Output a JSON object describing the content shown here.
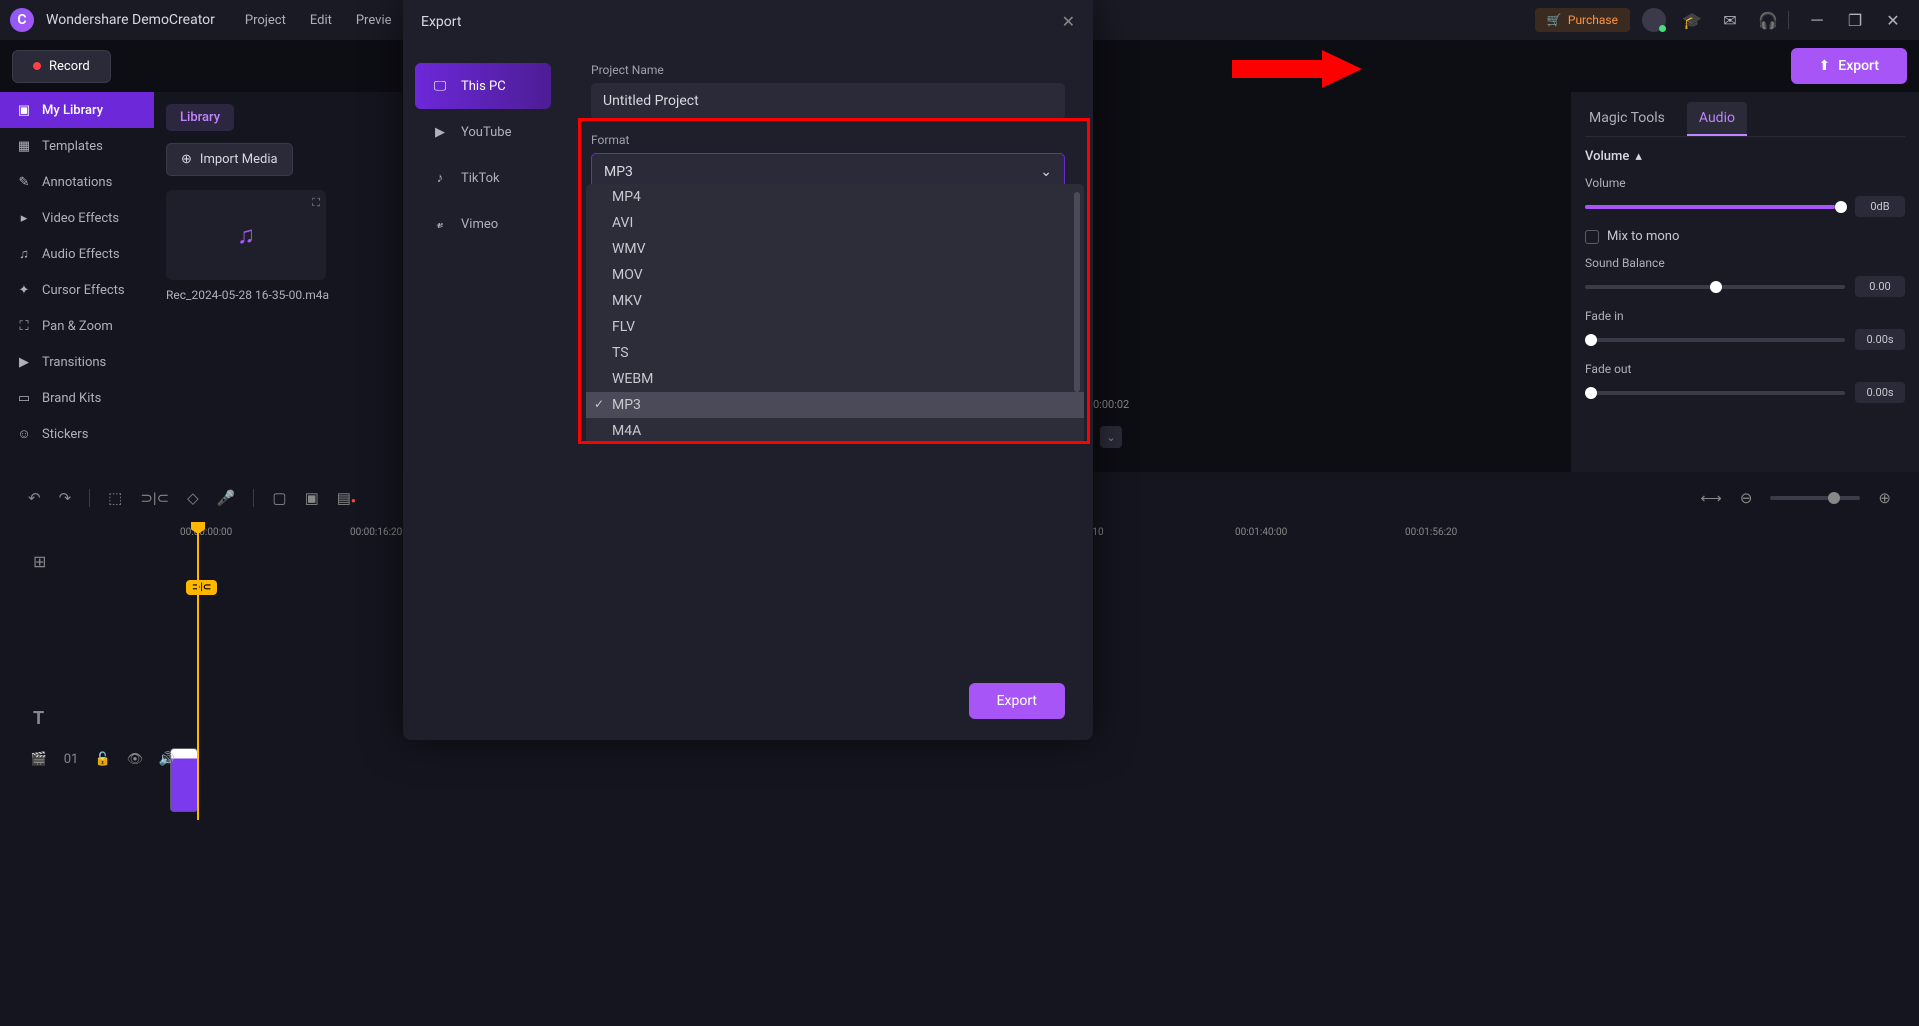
{
  "titlebar": {
    "appname": "Wondershare DemoCreator",
    "menus": [
      "Project",
      "Edit",
      "Previe"
    ],
    "purchase": "Purchase"
  },
  "toolbar": {
    "record": "Record",
    "export": "Export"
  },
  "sidebar": {
    "items": [
      {
        "label": "My Library",
        "icon": "library"
      },
      {
        "label": "Templates",
        "icon": "templates"
      },
      {
        "label": "Annotations",
        "icon": "annotations"
      },
      {
        "label": "Video Effects",
        "icon": "video-fx"
      },
      {
        "label": "Audio Effects",
        "icon": "audio-fx"
      },
      {
        "label": "Cursor Effects",
        "icon": "cursor-fx"
      },
      {
        "label": "Pan & Zoom",
        "icon": "pan-zoom"
      },
      {
        "label": "Transitions",
        "icon": "transitions"
      },
      {
        "label": "Brand Kits",
        "icon": "brand"
      },
      {
        "label": "Stickers",
        "icon": "stickers"
      }
    ]
  },
  "library": {
    "header": "Library",
    "import": "Import Media",
    "media_name": "Rec_2024-05-28 16-35-00.m4a"
  },
  "props": {
    "tab1": "Magic Tools",
    "tab2": "Audio",
    "volume_section": "Volume",
    "volume_label": "Volume",
    "volume_value": "0dB",
    "mix_mono": "Mix to mono",
    "sound_balance": "Sound Balance",
    "balance_value": "0.00",
    "fade_in": "Fade in",
    "fade_in_value": "0.00s",
    "fade_out": "Fade out",
    "fade_out_value": "0.00s"
  },
  "timeline": {
    "marks": [
      "00:00:00:00",
      "00:00:16:20",
      ":10",
      "00:01:40:00",
      "00:01:56:20"
    ],
    "track_num": "01",
    "cut": "⊃|⊂"
  },
  "dialog": {
    "title": "Export",
    "tabs": [
      "This PC",
      "YouTube",
      "TikTok",
      "Vimeo"
    ],
    "project_name_label": "Project Name",
    "project_name_value": "Untitled Project",
    "format_label": "Format",
    "format_value": "MP3",
    "format_options": [
      "MP4",
      "AVI",
      "WMV",
      "MOV",
      "MKV",
      "FLV",
      "TS",
      "WEBM",
      "MP3",
      "M4A"
    ],
    "export_btn": "Export"
  },
  "preview": {
    "time": "0:00:02"
  }
}
